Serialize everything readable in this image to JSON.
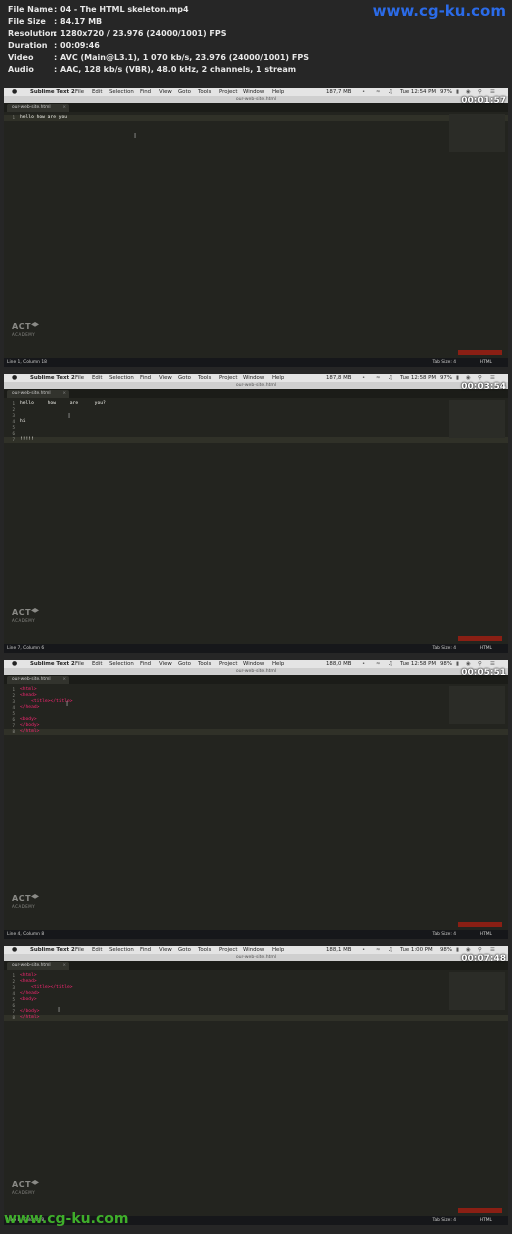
{
  "file_info": {
    "rows": [
      {
        "label": "File Name",
        "value": "04 - The HTML skeleton.mp4"
      },
      {
        "label": "File Size",
        "value": "84.17 MB"
      },
      {
        "label": "Resolution",
        "value": "1280x720 / 23.976 (24000/1001) FPS"
      },
      {
        "label": "Duration",
        "value": "00:09:46"
      },
      {
        "label": "Video",
        "value": "AVC (Main@L3.1), 1 070 kb/s, 23.976 (24000/1001) FPS"
      },
      {
        "label": "Audio",
        "value": "AAC, 128 kb/s (VBR), 48.0 kHz, 2 channels, 1 stream"
      }
    ],
    "separator": ":"
  },
  "watermark": {
    "text": "www.cg-ku.com"
  },
  "menubar": {
    "apple": "",
    "app": "Sublime Text 2",
    "items": [
      "File",
      "Edit",
      "Selection",
      "Find",
      "View",
      "Goto",
      "Tools",
      "Project",
      "Window",
      "Help"
    ]
  },
  "window_title": "our-web-site.html",
  "tab_label": "our-web-site.html",
  "tab_close": "×",
  "logo": {
    "text": "ACT",
    "sub": "ACADEMY"
  },
  "cursor_glyph": "I",
  "frames": [
    {
      "timestamp": "00:01:57",
      "clock": "Tue 12:54 PM",
      "memory": "187,7 MB",
      "battery": "97%",
      "status": "Line 1, Column 18",
      "tab_size": "Tab Size: 4",
      "language": "HTML",
      "lines": [
        {
          "n": "1",
          "text": "hello how are you"
        }
      ]
    },
    {
      "timestamp": "00:03:54",
      "clock": "Tue 12:58 PM",
      "memory": "187,8 MB",
      "battery": "97%",
      "status": "Line 7, Column 6",
      "tab_size": "Tab Size: 4",
      "language": "HTML",
      "lines": [
        {
          "n": "1",
          "text": "hello     how     are      you?"
        },
        {
          "n": "2",
          "text": ""
        },
        {
          "n": "3",
          "text": ""
        },
        {
          "n": "4",
          "text": "hi"
        },
        {
          "n": "5",
          "text": ""
        },
        {
          "n": "6",
          "text": ""
        },
        {
          "n": "7",
          "text": "!!!!!"
        }
      ]
    },
    {
      "timestamp": "00:05:51",
      "clock": "Tue 12:58 PM",
      "memory": "188,0 MB",
      "battery": "98%",
      "status": "Line 4, Column 8",
      "tab_size": "Tab Size: 4",
      "language": "HTML",
      "lines": [
        {
          "n": "1",
          "text": "<html>"
        },
        {
          "n": "2",
          "text": "<head>"
        },
        {
          "n": "3",
          "text": "    <title></title>"
        },
        {
          "n": "4",
          "text": "</head>"
        },
        {
          "n": "5",
          "text": ""
        },
        {
          "n": "6",
          "text": "<body>"
        },
        {
          "n": "7",
          "text": "</body>"
        },
        {
          "n": "8",
          "text": "</html>"
        }
      ]
    },
    {
      "timestamp": "00:07:48",
      "clock": "Tue 1:00 PM",
      "memory": "188,1 MB",
      "battery": "98%",
      "status": "Line 8, Column 8",
      "tab_size": "Tab Size: 4",
      "language": "HTML",
      "lines": [
        {
          "n": "1",
          "text": "<html>"
        },
        {
          "n": "2",
          "text": "<head>"
        },
        {
          "n": "3",
          "text": "    <title></title>"
        },
        {
          "n": "4",
          "text": "</head>"
        },
        {
          "n": "5",
          "text": "<body>"
        },
        {
          "n": "6",
          "text": ""
        },
        {
          "n": "7",
          "text": "</body>"
        },
        {
          "n": "8",
          "text": "</html>"
        }
      ]
    }
  ]
}
